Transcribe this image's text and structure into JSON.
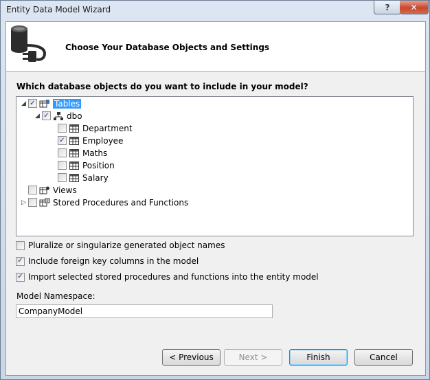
{
  "window": {
    "title": "Entity Data Model Wizard",
    "help_label": "?",
    "close_label": "✕"
  },
  "header": {
    "title": "Choose Your Database Objects and Settings"
  },
  "question": "Which database objects do you want to include in your model?",
  "tree": {
    "tables_label": "Tables",
    "schema_label": "dbo",
    "tables": [
      {
        "label": "Department",
        "checked": false
      },
      {
        "label": "Employee",
        "checked": true
      },
      {
        "label": "Maths",
        "checked": false
      },
      {
        "label": "Position",
        "checked": false
      },
      {
        "label": "Salary",
        "checked": false
      }
    ],
    "views_label": "Views",
    "procs_label": "Stored Procedures and Functions"
  },
  "options": {
    "pluralize": {
      "label": "Pluralize or singularize generated object names",
      "checked": false
    },
    "foreign_keys": {
      "label": "Include foreign key columns in the model",
      "checked": true
    },
    "import_procs": {
      "label": "Import selected stored procedures and functions into the entity model",
      "checked": true
    }
  },
  "namespace": {
    "label": "Model Namespace:",
    "value": "CompanyModel"
  },
  "buttons": {
    "previous": "< Previous",
    "next": "Next >",
    "finish": "Finish",
    "cancel": "Cancel"
  },
  "colors": {
    "selection": "#3399ff",
    "close_button": "#c7472d"
  }
}
